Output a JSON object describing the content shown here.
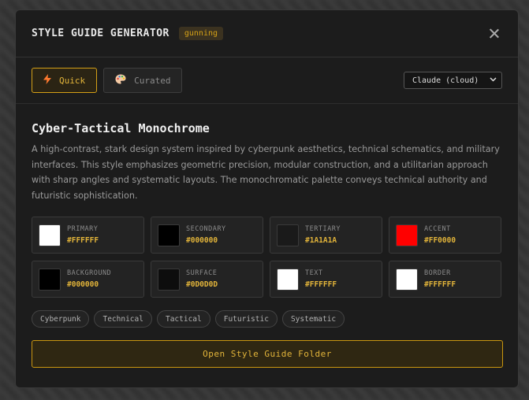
{
  "header": {
    "title": "STYLE GUIDE GENERATOR",
    "badge": "gunning"
  },
  "toolbar": {
    "modes": [
      {
        "label": "Quick",
        "icon": "lightning-icon",
        "active": true
      },
      {
        "label": "Curated",
        "icon": "palette-icon",
        "active": false
      }
    ],
    "model_select": {
      "value": "Claude (cloud)"
    }
  },
  "style": {
    "name": "Cyber-Tactical Monochrome",
    "description": "A high-contrast, stark design system inspired by cyberpunk aesthetics, technical schematics, and military interfaces. This style emphasizes geometric precision, modular construction, and a utilitarian approach with sharp angles and systematic layouts. The monochromatic palette conveys technical authority and futuristic sophistication."
  },
  "swatches": [
    {
      "label": "PRIMARY",
      "hex": "#FFFFFF"
    },
    {
      "label": "SECONDARY",
      "hex": "#000000"
    },
    {
      "label": "TERTIARY",
      "hex": "#1A1A1A"
    },
    {
      "label": "ACCENT",
      "hex": "#FF0000"
    },
    {
      "label": "BACKGROUND",
      "hex": "#000000"
    },
    {
      "label": "SURFACE",
      "hex": "#0D0D0D"
    },
    {
      "label": "TEXT",
      "hex": "#FFFFFF"
    },
    {
      "label": "BORDER",
      "hex": "#FFFFFF"
    }
  ],
  "tags": [
    "Cyberpunk",
    "Technical",
    "Tactical",
    "Futuristic",
    "Systematic"
  ],
  "actions": {
    "open_folder": "Open Style Guide Folder"
  },
  "colors": {
    "accent": "#d4a017",
    "modal_bg": "#1c1c1c"
  }
}
